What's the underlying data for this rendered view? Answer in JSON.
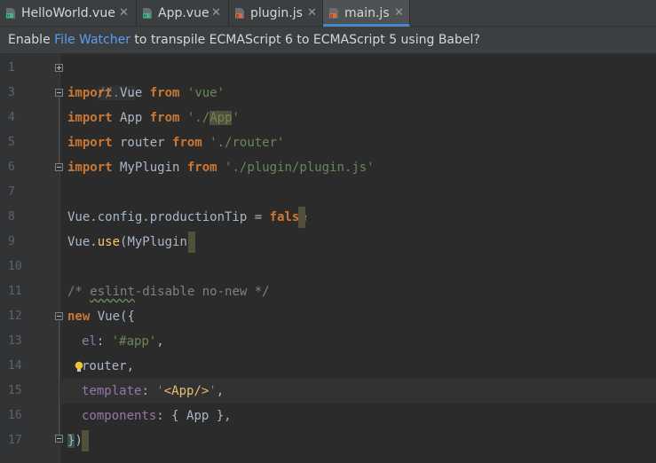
{
  "tabs": [
    {
      "label": "HelloWorld.vue",
      "icon": "vue-file-icon",
      "active": false
    },
    {
      "label": "App.vue",
      "icon": "vue-file-icon",
      "active": false
    },
    {
      "label": "plugin.js",
      "icon": "js-file-icon",
      "active": false
    },
    {
      "label": "main.js",
      "icon": "js-file-icon",
      "active": true
    }
  ],
  "notification": {
    "prefix": "Enable ",
    "link": "File Watcher",
    "suffix": " to transpile ECMAScript 6 to ECMAScript 5 using Babel?"
  },
  "line_numbers": [
    "1",
    "3",
    "4",
    "5",
    "6",
    "7",
    "8",
    "9",
    "10",
    "11",
    "12",
    "13",
    "14",
    "15",
    "16",
    "17"
  ],
  "code": {
    "l1": "//...",
    "l3": {
      "kw1": "import",
      "name": " Vue ",
      "kw2": "from",
      "sp": " ",
      "str": "'vue'"
    },
    "l4": {
      "kw1": "import",
      "name": " App ",
      "kw2": "from",
      "sp": " ",
      "str_a": "'./",
      "str_b": "App",
      "str_c": "'"
    },
    "l5": {
      "kw1": "import",
      "name": " router ",
      "kw2": "from",
      "sp": " ",
      "str": "'./router'"
    },
    "l6": {
      "kw1": "import",
      "name": " MyPlugin ",
      "kw2": "from",
      "sp": " ",
      "str": "'./plugin/plugin.js'"
    },
    "l8": {
      "obj": "Vue.config.productionTip = ",
      "kw": "false"
    },
    "l9": {
      "obj": "Vue.",
      "fn": "use",
      "args": "(MyPlugin)"
    },
    "l11": {
      "a": "/* ",
      "b": "eslint",
      "c": "-disable no-new */"
    },
    "l12": {
      "kw": "new",
      "rest": " Vue({"
    },
    "l13": {
      "prop": "el",
      "colon": ": ",
      "str": "'#app'",
      "comma": ","
    },
    "l14": {
      "text": "router,"
    },
    "l15": {
      "prop": "template",
      "colon": ": ",
      "q1": "'",
      "tag": "<App/>",
      "q2": "'",
      "comma": ","
    },
    "l16": {
      "prop": "components",
      "rest": ": { App },"
    },
    "l17": {
      "brace": "}",
      "paren": ")"
    }
  },
  "colors": {
    "background": "#2b2b2b",
    "keyword": "#cc7832",
    "string": "#6a8759",
    "comment": "#808080",
    "property": "#9876aa",
    "function": "#ffc66d",
    "link": "#589df6"
  }
}
